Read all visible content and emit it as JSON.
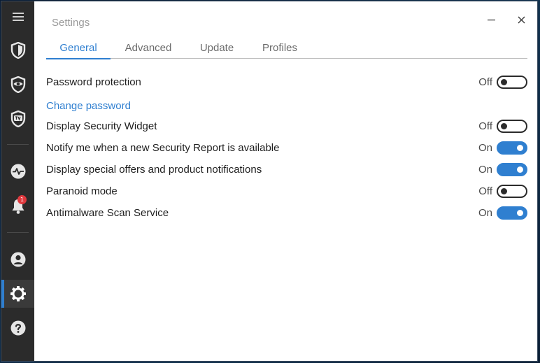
{
  "window": {
    "title": "Settings"
  },
  "tabs": [
    {
      "label": "General",
      "active": true
    },
    {
      "label": "Advanced",
      "active": false
    },
    {
      "label": "Update",
      "active": false
    },
    {
      "label": "Profiles",
      "active": false
    }
  ],
  "sidebar": {
    "items": [
      {
        "icon": "menu-icon"
      },
      {
        "icon": "shield-icon"
      },
      {
        "icon": "eye-shield-icon"
      },
      {
        "icon": "tv-shield-icon"
      },
      {
        "icon": "activity-icon"
      },
      {
        "icon": "bell-icon",
        "badge": "1"
      },
      {
        "icon": "user-icon"
      },
      {
        "icon": "gear-icon",
        "active": true
      },
      {
        "icon": "help-icon"
      }
    ]
  },
  "settings": {
    "password_protection": {
      "label": "Password protection",
      "state": "Off"
    },
    "change_password": "Change password",
    "display_widget": {
      "label": "Display Security Widget",
      "state": "Off"
    },
    "notify_report": {
      "label": "Notify me when a new Security Report is available",
      "state": "On"
    },
    "special_offers": {
      "label": "Display special offers and product notifications",
      "state": "On"
    },
    "paranoid": {
      "label": "Paranoid mode",
      "state": "Off"
    },
    "antimalware": {
      "label": "Antimalware Scan Service",
      "state": "On"
    }
  },
  "colors": {
    "accent": "#2f7fd0",
    "sidebar_bg": "#2b2b2b",
    "badge": "#e0393e"
  }
}
